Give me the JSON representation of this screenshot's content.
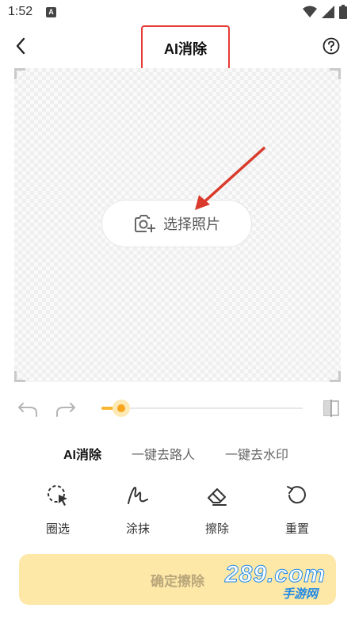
{
  "status_bar": {
    "time": "1:52",
    "notification_badge": "A"
  },
  "header": {
    "title": "AI消除"
  },
  "canvas": {
    "select_photo_label": "选择照片"
  },
  "brush": {
    "size_fraction": 0.1
  },
  "tabs": [
    {
      "label": "AI消除",
      "active": true
    },
    {
      "label": "一键去路人",
      "active": false
    },
    {
      "label": "一键去水印",
      "active": false
    }
  ],
  "tools": [
    {
      "label": "圈选",
      "icon": "lasso-select-icon"
    },
    {
      "label": "涂抹",
      "icon": "brush-smear-icon"
    },
    {
      "label": "擦除",
      "icon": "eraser-icon"
    },
    {
      "label": "重置",
      "icon": "reset-icon"
    }
  ],
  "confirm": {
    "label": "确定擦除"
  },
  "watermark": {
    "main": "289.com",
    "sub": "手游网"
  },
  "colors": {
    "accent": "#f7a51d",
    "confirm_bg": "#fde8a8",
    "highlight_red": "#e53935"
  }
}
